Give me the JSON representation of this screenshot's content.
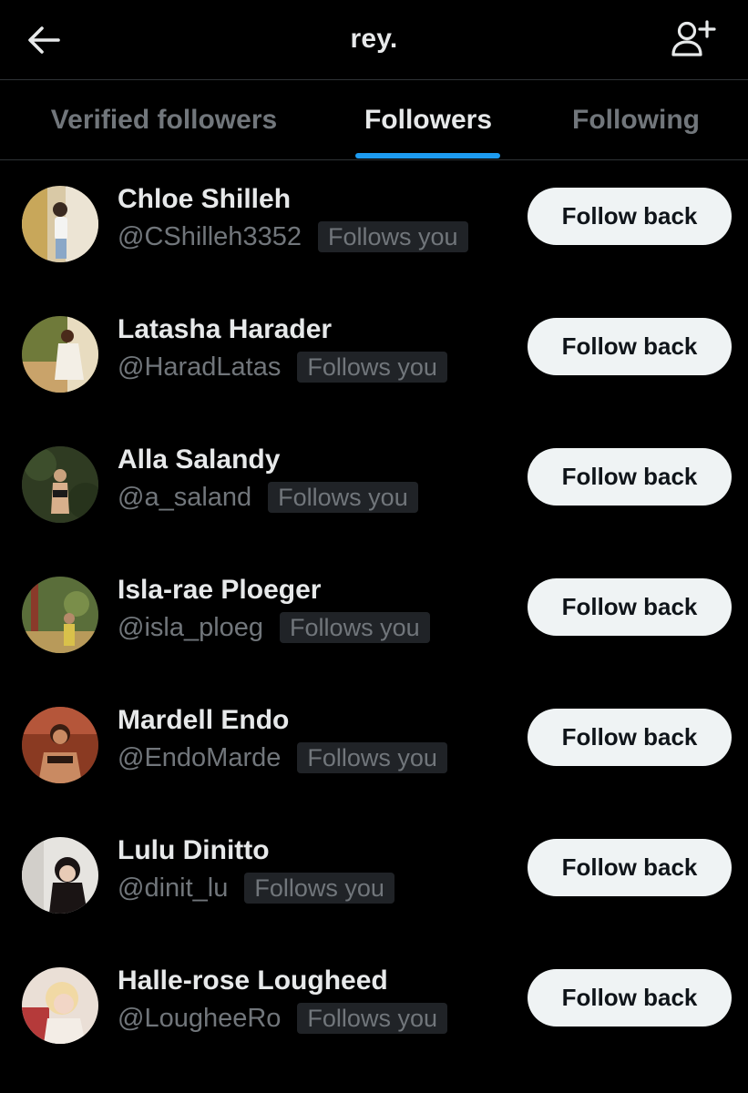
{
  "header": {
    "title": "rey.",
    "back_icon": "arrow-left-icon",
    "add_icon": "add-user-icon"
  },
  "tabs": [
    {
      "label": "Verified followers",
      "active": false
    },
    {
      "label": "Followers",
      "active": true
    },
    {
      "label": "Following",
      "active": false
    }
  ],
  "colors": {
    "background": "#000000",
    "text_primary": "#e7e9ea",
    "text_secondary": "#71767b",
    "accent": "#1d9bf0",
    "button_bg": "#eff3f4",
    "badge_bg": "#202327"
  },
  "followers": [
    {
      "name": "Chloe Shilleh",
      "handle": "@CShilleh3352",
      "badge": "Follows you",
      "button": "Follow back"
    },
    {
      "name": "Latasha Harader",
      "handle": "@HaradLatas",
      "badge": "Follows you",
      "button": "Follow back"
    },
    {
      "name": "Alla Salandy",
      "handle": "@a_saland",
      "badge": "Follows you",
      "button": "Follow back"
    },
    {
      "name": "Isla-rae Ploeger",
      "handle": "@isla_ploeg",
      "badge": "Follows you",
      "button": "Follow back"
    },
    {
      "name": "Mardell Endo",
      "handle": "@EndoMarde",
      "badge": "Follows you",
      "button": "Follow back"
    },
    {
      "name": "Lulu Dinitto",
      "handle": "@dinit_lu",
      "badge": "Follows you",
      "button": "Follow back"
    },
    {
      "name": "Halle-rose Lougheed",
      "handle": "@LougheeRo",
      "badge": "Follows you",
      "button": "Follow back"
    }
  ]
}
